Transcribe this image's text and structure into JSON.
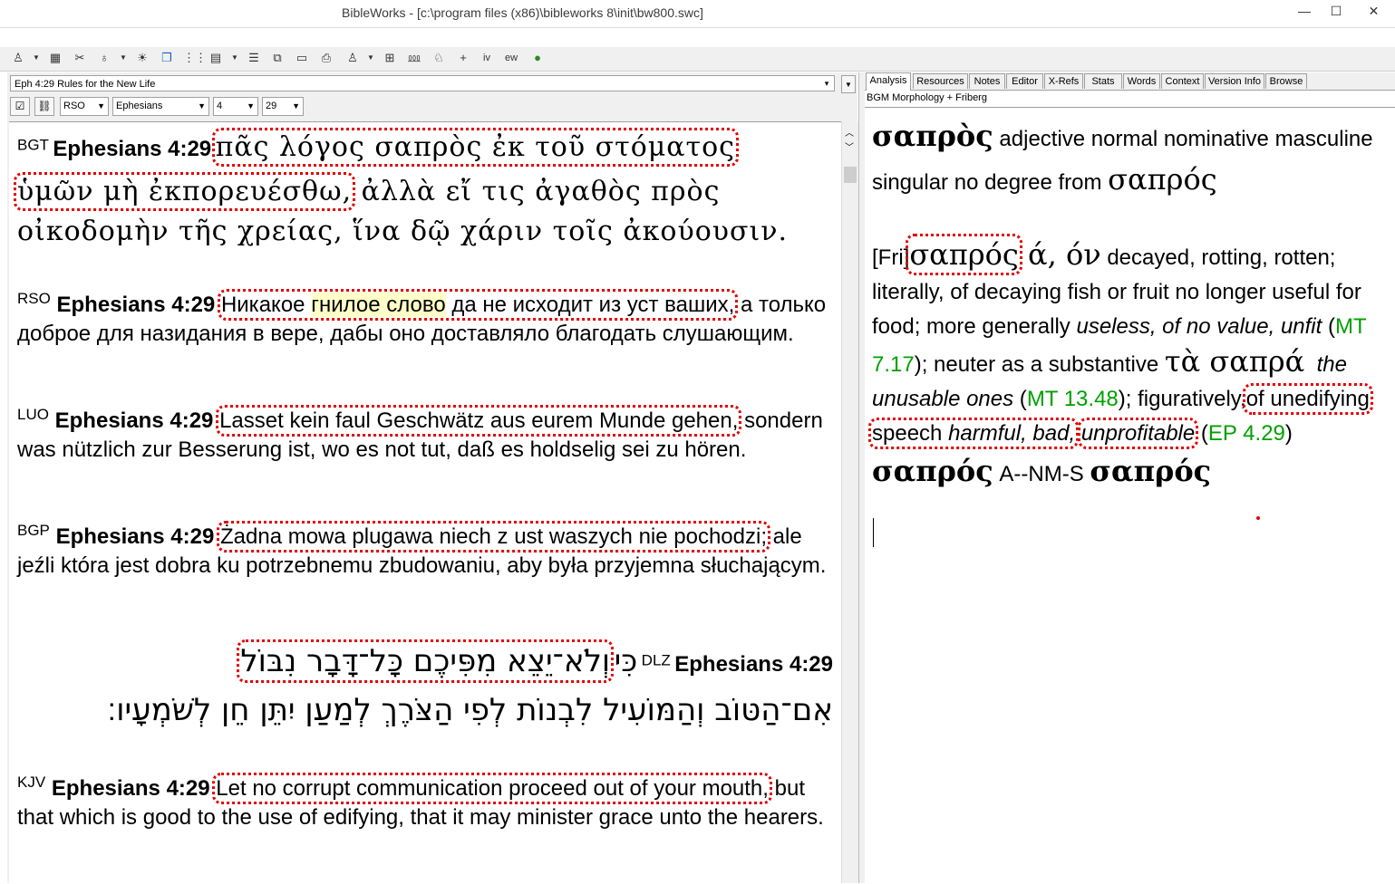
{
  "window": {
    "title": "BibleWorks - [c:\\program files (x86)\\bibleworks 8\\init\\bw800.swc]",
    "min": "—",
    "max": "☐",
    "close": "✕"
  },
  "toolbar": {
    "icons": [
      "person-icon",
      "folder-icon",
      "tools-icon",
      "pin-icon",
      "sun-icon",
      "windows-icon",
      "dots-icon",
      "grid-icon",
      "list-icon",
      "copy-icon",
      "notes-icon",
      "print-icon",
      "person2-icon",
      "boxes-icon",
      "script-icon",
      "person3-icon",
      "plus-icon",
      "iv-icon",
      "ew-icon",
      "globe-icon"
    ]
  },
  "left": {
    "reference": "Eph 4:29 Rules for the New Life",
    "version": "RSO",
    "book": "Ephesians",
    "chapter": "4",
    "verse": "29",
    "verses": [
      {
        "ver": "BGT",
        "ref": "Ephesians 4:29",
        "line1a": "πᾶς λόγος σαπρὸς ἐκ τοῦ στόματος",
        "line2a": "ὑμῶν μὴ ἐκπορευέσθω,",
        "line2b": " ἀλλὰ εἴ τις ἀγαθὸς πρὸς",
        "line3": "οἰκοδομὴν τῆς χρείας, ἵνα δῷ χάριν τοῖς ἀκούουσιν."
      },
      {
        "ver": "RSO",
        "ref": "Ephesians 4:29",
        "pre": "Никакое ",
        "hl": "гнилое слово",
        "post": " да не исходит из уст ваших,",
        "rest": " а только доброе для назидания в вере, дабы оно доставляло благодать слушающим."
      },
      {
        "ver": "LUO",
        "ref": "Ephesians 4:29",
        "marked": "Lasset kein faul Geschwätz aus eurem Munde gehen,",
        "rest": " sondern was nützlich zur Besserung ist, wo es not tut, daß es holdselig sei zu hören."
      },
      {
        "ver": "BGP",
        "ref": "Ephesians 4:29",
        "marked": "Żadna mowa plugawa niech z ust waszych nie pochodzi;",
        "rest": " ale jeźli która jest dobra ku potrzebnemu zbudowaniu, aby była przyjemna słuchającym."
      },
      {
        "ver": "DLZ",
        "ref": "Ephesians 4:29",
        "marked": "וְלֹא־יֵצֵא מִפִּיכֶם כָּל־דָּבָר נִבּוֹל",
        "tail": " כִּי",
        "line2": "אִם־הַטּוֹב וְהַמּוֹעִיל לִבְנוֹת לְפִי הַצֹּרֶךְ לְמַעַן יִתֵּן חֵן לְשֹׁמְעָיו׃"
      },
      {
        "ver": "KJV",
        "ref": "Ephesians 4:29",
        "marked": "Let no corrupt communication proceed out of your mouth,",
        "rest": " but that which is good to the use of edifying, that it may minister grace unto the hearers."
      }
    ]
  },
  "right": {
    "tabs": [
      "Analysis",
      "Resources",
      "Notes",
      "Editor",
      "X-Refs",
      "Stats",
      "Words",
      "Context",
      "Version Info",
      "Browse"
    ],
    "subhead": "BGM Morphology + Friberg",
    "word1": "σαπρὸς",
    "morph1": "  adjective normal nominative masculine singular no degree from ",
    "lemma1": "σαπρός",
    "fri_tag": "[Fri]",
    "fri_word": "σαπρός",
    "fri_forms": " ά, όν",
    "def1": "  decayed, rotting, rotten; literally, of decaying fish or fruit no longer useful for food; more generally ",
    "def1_it": "useless, of no value, unfit",
    "ref1": "MT 7.17",
    "def2": "); neuter as a substantive ",
    "ta": "τὰ σαπρά",
    "def2_it": "the unusable ones",
    "ref2": "MT 13.48",
    "def3": "); figuratively,",
    "def3_marked": "of unedifying speech ",
    "def3_it": "harmful, bad,",
    "def3_it2": "unprofitable",
    "ref3": "EP 4.29",
    "word2": "σαπρός",
    "parse2": "  A--NM-S ",
    "lemma2": "σαπρός"
  }
}
